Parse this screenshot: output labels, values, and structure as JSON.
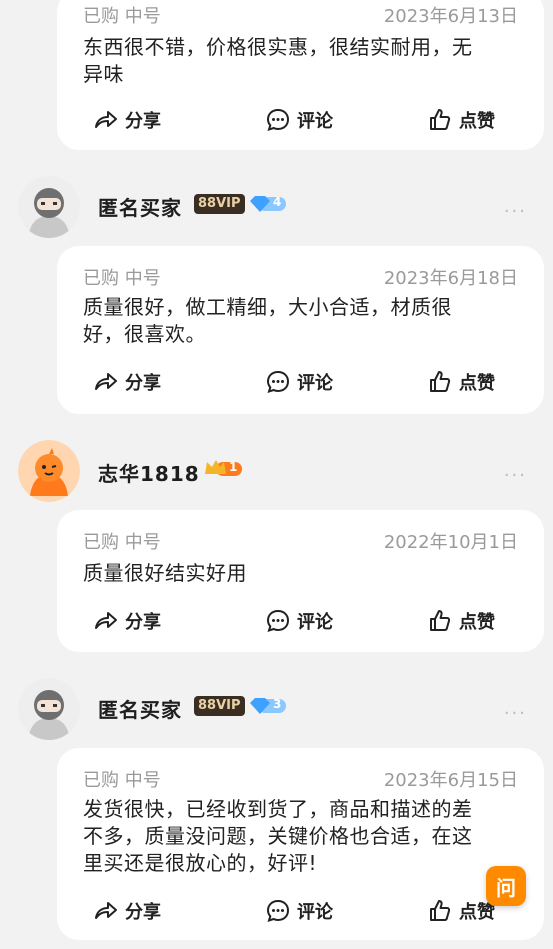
{
  "accent_color": "#ff8a00",
  "actions": {
    "share": "分享",
    "comment": "评论",
    "like": "点赞"
  },
  "reviews": [
    {
      "spec": "已购 中号",
      "date": "2023年6月13日",
      "line1": "东西很不错，价格很实惠，很结实耐用，无",
      "line2": "异味"
    },
    {
      "user": "匿名买家",
      "vip": "88VIP",
      "level": "4",
      "spec": "已购 中号",
      "date": "2023年6月18日",
      "line1": "质量很好，做工精细，大小合适，材质很",
      "line2": "好，很喜欢。"
    },
    {
      "user": "志华1818",
      "level": "1",
      "spec": "已购 中号",
      "date": "2022年10月1日",
      "line1": "质量很好结实好用",
      "line2": ""
    },
    {
      "user": "匿名买家",
      "vip": "88VIP",
      "level": "3",
      "spec": "已购 中号",
      "date": "2023年6月15日",
      "line1": "发货很快，已经收到货了，商品和描述的差",
      "line2": "不多，质量没问题，关键价格也合适，在这",
      "line3": "里买还是很放心的，好评!"
    }
  ],
  "more_icon": "...",
  "ask_button": "问"
}
